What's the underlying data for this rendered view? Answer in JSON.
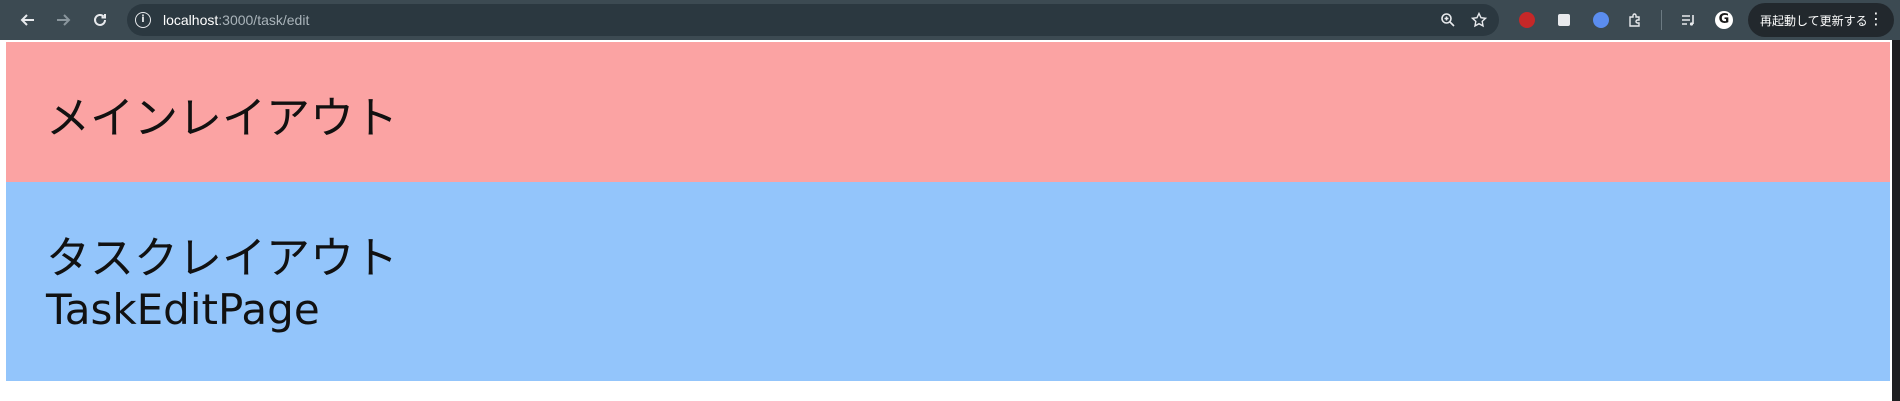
{
  "browser": {
    "url_host": "localhost",
    "url_path": ":3000/task/edit",
    "update_button_label": "再起動して更新する",
    "icons": {
      "back": "back-arrow-icon",
      "forward": "forward-arrow-icon",
      "reload": "reload-icon",
      "site_info": "info-icon",
      "zoom": "zoom-icon",
      "bookmark": "star-icon",
      "menu": "more-vert-icon"
    }
  },
  "page": {
    "main_layout_title": "メインレイアウト",
    "task_layout_title": "タスクレイアウト",
    "page_name": "TaskEditPage"
  },
  "colors": {
    "main_layout_bg": "#fba3a3",
    "task_layout_bg": "#93c5fb"
  }
}
